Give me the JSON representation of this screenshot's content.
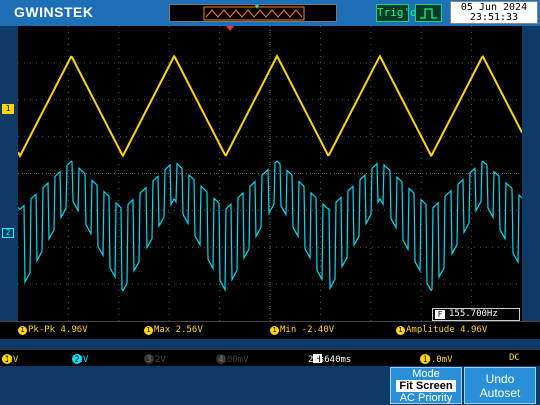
{
  "header": {
    "brand": "GWINSTEK",
    "trigger_status": "Trig'd",
    "date": "05 Jun 2024",
    "time": "23:51:33"
  },
  "markers": {
    "ch1": "1",
    "ch2": "2"
  },
  "frequency": {
    "icon": "F",
    "value": "155.700Hz"
  },
  "measurements": [
    {
      "channel": "1",
      "text": "Pk-Pk 4.96V"
    },
    {
      "channel": "1",
      "text": "Max 2.56V"
    },
    {
      "channel": "1",
      "text": "Min -2.40V"
    },
    {
      "channel": "1",
      "text": "Amplitude 4.96V"
    }
  ],
  "channel_bar": {
    "ch1_num": "1",
    "ch1_coupling": "═",
    "ch1_scale": "2V",
    "ch2_num": "2",
    "ch2_coupling": "~",
    "ch2_scale": "2V",
    "ch3_num": "3",
    "ch3_scale": "2V",
    "ch4_num": "4",
    "ch4_scale": "100mV",
    "timebase": "2ms",
    "hpos_icon": "H",
    "hpos": "1.640ms",
    "trig_ch": "1",
    "trig_slope": "f",
    "trig_level": "80.0mV",
    "trig_coupling": "DC"
  },
  "buttons": {
    "mode_line1": "Mode",
    "mode_line2": "Fit Screen",
    "mode_line3": "AC Priority",
    "undo_line1": "Undo",
    "undo_line2": "Autoset"
  },
  "colors": {
    "ch1": "#ffd700",
    "ch2": "#00e5ff",
    "accent": "#1d6fb8"
  },
  "waveforms": {
    "ch1": {
      "shape": "triangle",
      "period_div": 2.04,
      "vpp_V": 4.96
    },
    "ch2": {
      "shape": "triangle-modulated",
      "period_div": 2.04
    }
  }
}
